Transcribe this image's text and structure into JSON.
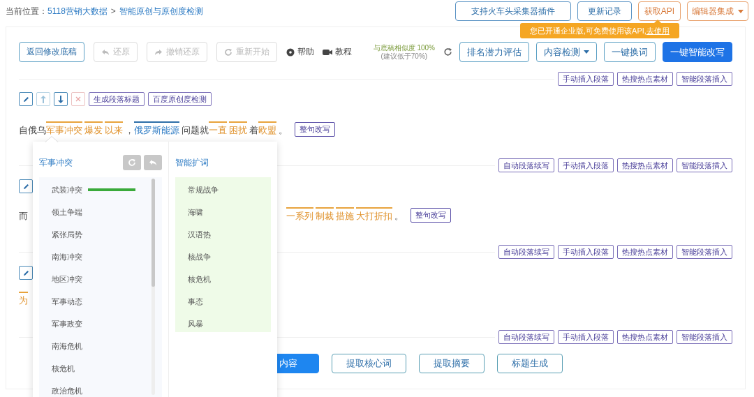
{
  "breadcrumb": {
    "label": "当前位置：",
    "items": [
      {
        "text": "5118营销大数据"
      },
      {
        "text": "智能原创与原创度检测"
      }
    ],
    "separator": ">"
  },
  "top_buttons": [
    {
      "label": "支持火车头采集器插件",
      "kind": "plain"
    },
    {
      "label": "更新记录",
      "kind": "plain"
    },
    {
      "label": "获取API",
      "kind": "accent"
    },
    {
      "label": "编辑器集成",
      "kind": "dropdown"
    }
  ],
  "tooltip": {
    "text": "您已开通企业版,可免费使用该API,",
    "link": "去使用"
  },
  "toolbar": {
    "left": [
      {
        "label": "返回修改底稿",
        "disabled": false,
        "kind": "back"
      },
      {
        "label": "还原",
        "disabled": true,
        "kind": "undo"
      },
      {
        "label": "撤销还原",
        "disabled": true,
        "kind": "redo"
      },
      {
        "label": "重新开始",
        "disabled": true,
        "kind": "restart"
      }
    ],
    "links": [
      {
        "label": "帮助",
        "kind": "help"
      },
      {
        "label": "教程",
        "kind": "tutorial"
      }
    ],
    "similarity": {
      "line1": "与底稿相似度 100%",
      "line2": "(建议低于70%)"
    },
    "right": [
      {
        "label": "排名潜力评估",
        "kind": "outline"
      },
      {
        "label": "内容检测",
        "kind": "dropdown"
      },
      {
        "label": "一键换词",
        "kind": "outline"
      },
      {
        "label": "一键智能改写",
        "kind": "primary"
      }
    ]
  },
  "top_actions": [
    "手动插入段落",
    "热搜热点素材",
    "智能段落插入"
  ],
  "blocks": [
    {
      "tools": [
        {
          "kind": "edit",
          "disabled": false
        },
        {
          "kind": "up",
          "disabled": true
        },
        {
          "kind": "down",
          "disabled": false
        },
        {
          "kind": "delete",
          "disabled": true
        },
        {
          "kind": "text",
          "label": "生成段落标题",
          "disabled": false
        },
        {
          "kind": "text",
          "label": "百度原创度检测",
          "disabled": false
        }
      ],
      "lead": [
        {
          "text": "自俄乌",
          "kind": "plain"
        },
        {
          "text": "军事冲突",
          "kind": "synonym"
        },
        {
          "text": "爆发",
          "kind": "synonym"
        },
        {
          "text": "以来",
          "kind": "synonym"
        },
        {
          "text": "，",
          "kind": "plain"
        },
        {
          "text": "俄罗斯能源",
          "kind": "entity"
        },
        {
          "text": "问题就",
          "kind": "plain"
        },
        {
          "text": "一直",
          "kind": "synonym"
        },
        {
          "text": "困扰",
          "kind": "synonym"
        },
        {
          "text": "着",
          "kind": "plain"
        },
        {
          "text": "欧盟",
          "kind": "synonym"
        },
        {
          "text": "。",
          "kind": "plain"
        }
      ],
      "rewrite": "整句改写",
      "actions": [
        "自动段落续写",
        "手动插入段落",
        "热搜热点素材",
        "智能段落插入"
      ]
    },
    {
      "tools": [
        {
          "kind": "edit",
          "disabled": false
        }
      ],
      "lead": [
        {
          "text": "而",
          "kind": "plain"
        }
      ],
      "tail": [
        {
          "text": "一系列",
          "kind": "synonym"
        },
        {
          "text": "制裁",
          "kind": "synonym"
        },
        {
          "text": "措施",
          "kind": "synonym"
        },
        {
          "text": "大打折扣",
          "kind": "synonym"
        },
        {
          "text": "。",
          "kind": "plain"
        }
      ],
      "rewrite": "整句改写",
      "actions": [
        "自动段落续写",
        "手动插入段落",
        "热搜热点素材",
        "智能段落插入"
      ]
    },
    {
      "tools": [
        {
          "kind": "edit",
          "disabled": false
        }
      ],
      "lead": [
        {
          "text": "为",
          "kind": "synonym"
        }
      ],
      "actions": [
        "自动段落续写",
        "手动插入段落",
        "热搜热点素材",
        "智能段落插入"
      ]
    }
  ],
  "bottom_buttons": [
    {
      "label": "内容",
      "kind": "primary"
    },
    {
      "label": "提取核心词",
      "kind": "outline"
    },
    {
      "label": "提取摘要",
      "kind": "outline"
    },
    {
      "label": "标题生成",
      "kind": "outline"
    }
  ],
  "popup": {
    "synonyms": {
      "title": "军事冲突",
      "items": [
        {
          "text": "武装冲突",
          "highlighted": true
        },
        {
          "text": "领土争端",
          "highlighted": false
        },
        {
          "text": "紧张局势",
          "highlighted": false
        },
        {
          "text": "南海冲突",
          "highlighted": false
        },
        {
          "text": "地区冲突",
          "highlighted": false
        },
        {
          "text": "军事动态",
          "highlighted": false
        },
        {
          "text": "军事政变",
          "highlighted": false
        },
        {
          "text": "南海危机",
          "highlighted": false
        },
        {
          "text": "核危机",
          "highlighted": false
        },
        {
          "text": "政治危机",
          "highlighted": false
        }
      ]
    },
    "expansion": {
      "title": "智能扩词",
      "items": [
        {
          "text": "常规战争"
        },
        {
          "text": "海啸"
        },
        {
          "text": "汉语热"
        },
        {
          "text": "核战争"
        },
        {
          "text": "核危机"
        },
        {
          "text": "事态"
        },
        {
          "text": "风暴"
        }
      ]
    }
  }
}
